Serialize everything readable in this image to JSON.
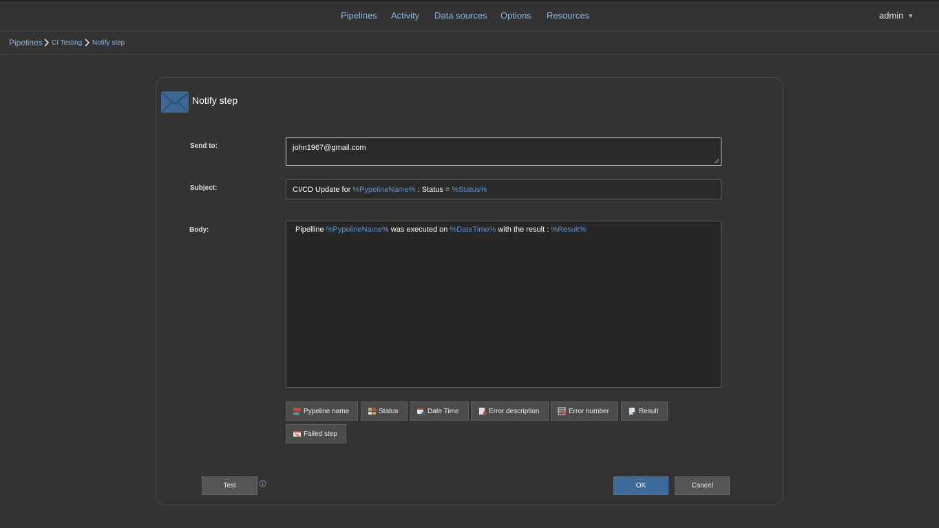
{
  "nav": {
    "items": [
      {
        "label": "Pipelines"
      },
      {
        "label": "Activity"
      },
      {
        "label": "Data sources"
      },
      {
        "label": "Options"
      },
      {
        "label": "Resources"
      }
    ],
    "user": "admin"
  },
  "breadcrumb": [
    "Pipelines",
    "CI Testing",
    "Notify step"
  ],
  "dialog": {
    "title": "Notify step",
    "icon": "envelope-icon",
    "send_to": {
      "label": "Send to:",
      "value": "john1967@gmail.com"
    },
    "subject": {
      "label": "Subject:",
      "parts": [
        "CI/CD Update for ",
        "%PypelineName%",
        " : Status = ",
        "%Status%"
      ]
    },
    "body": {
      "label": "Body:",
      "parts": [
        "Pipelline ",
        "%PypelineName%",
        " was executed on ",
        "%DateTime%",
        " with the result : ",
        "%Result%"
      ]
    },
    "variable_color": "#5f93cf",
    "variables": [
      {
        "label": "Pypeline name",
        "icon": "text-abc-icon"
      },
      {
        "label": "Status",
        "icon": "status-icon"
      },
      {
        "label": "Date Time",
        "icon": "calendar-clock-icon"
      },
      {
        "label": "Error description",
        "icon": "error-document-icon"
      },
      {
        "label": "Error number",
        "icon": "error-number-icon"
      },
      {
        "label": "Result",
        "icon": "result-document-icon"
      },
      {
        "label": "Failed step",
        "icon": "failed-step-icon"
      }
    ],
    "buttons": {
      "test": "Test",
      "ok": "OK",
      "cancel": "Cancel"
    },
    "accent_color": "#3f6a99"
  }
}
